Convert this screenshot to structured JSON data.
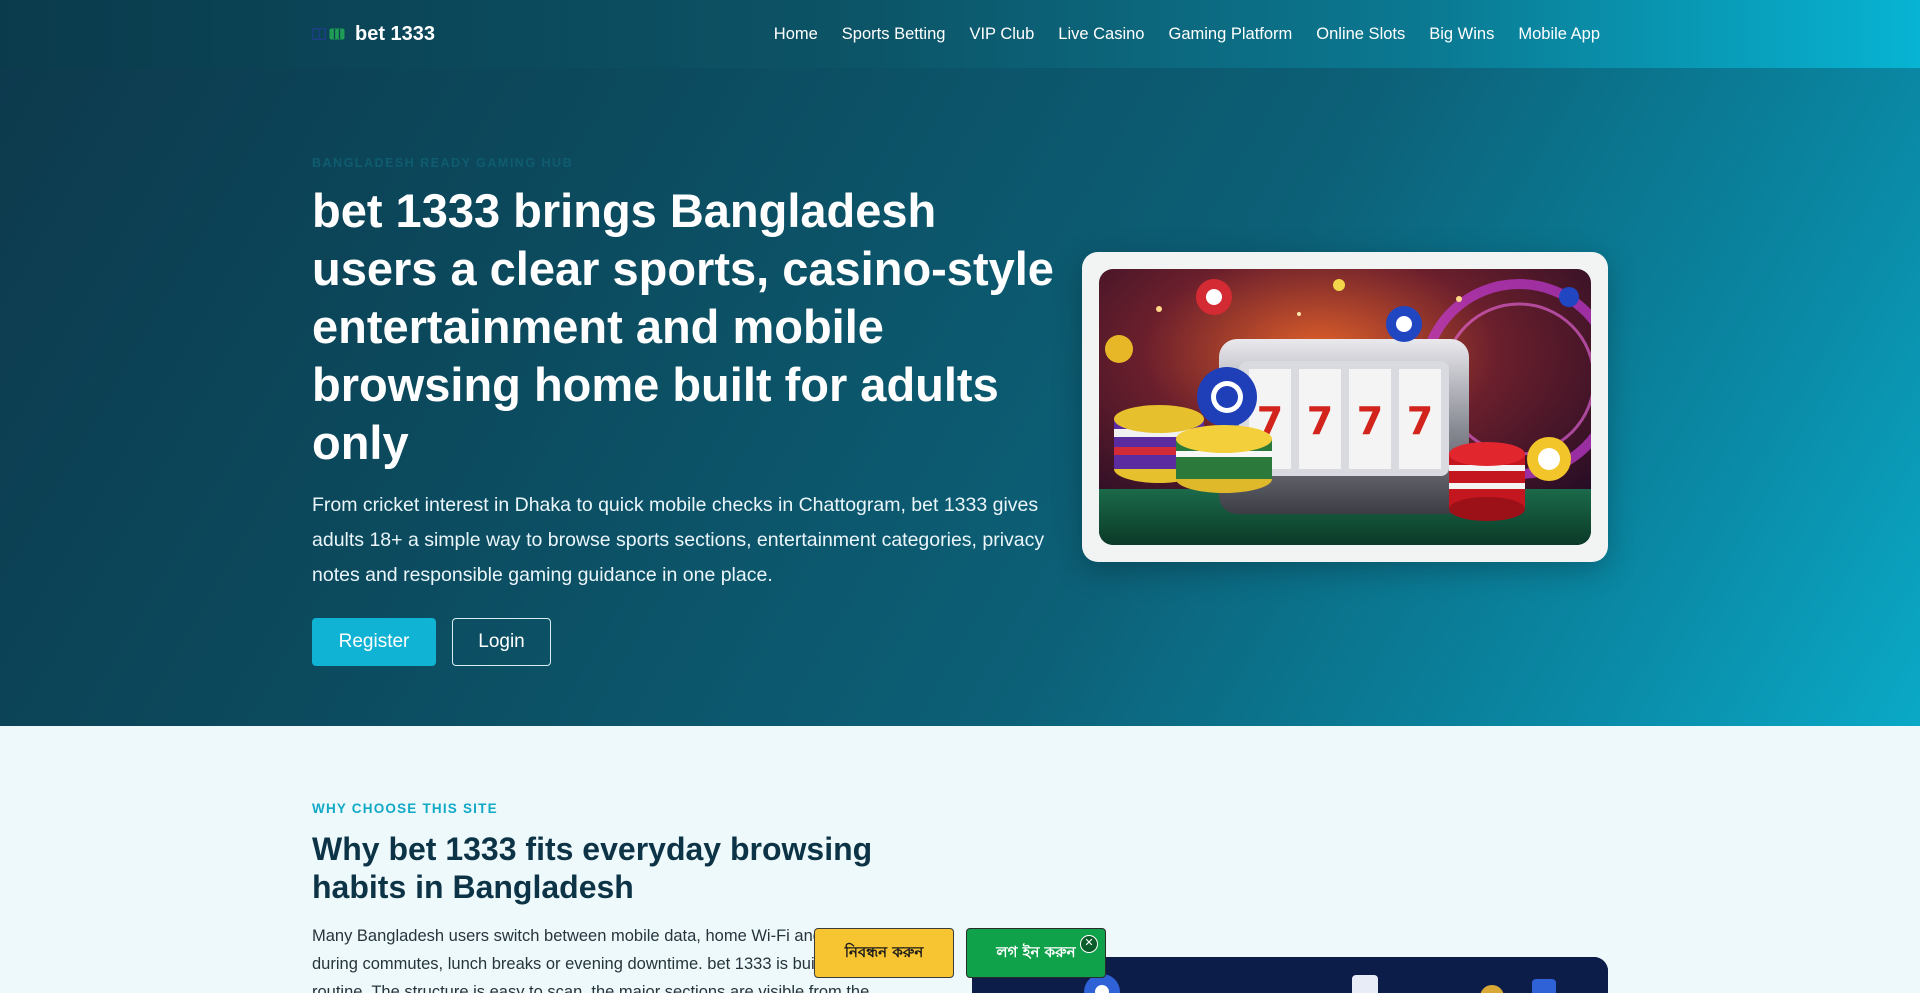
{
  "header": {
    "brand": "bet 1333",
    "nav": [
      "Home",
      "Sports Betting",
      "VIP Club",
      "Live Casino",
      "Gaming Platform",
      "Online Slots",
      "Big Wins",
      "Mobile App"
    ]
  },
  "hero": {
    "eyebrow": "Bangladesh ready gaming hub",
    "title": "bet 1333 brings Bangladesh users a clear sports, casino-style entertainment and mobile browsing home built for adults only",
    "description": "From cricket interest in Dhaka to quick mobile checks in Chattogram, bet 1333 gives adults 18+ a simple way to browse sports sections, entertainment categories, privacy notes and responsible gaming guidance in one place.",
    "register_label": "Register",
    "login_label": "Login",
    "image_icon": "slot-machine-casino-chips-image"
  },
  "why": {
    "eyebrow": "WHY CHOOSE THIS SITE",
    "title": "Why bet 1333 fits everyday browsing habits in Bangladesh",
    "body": "Many Bangladesh users switch between mobile data, home Wi-Fi and short sessions during commutes, lunch breaks or evening downtime. bet 1333 is built around that routine. The structure is easy to scan, the major sections are visible from the"
  },
  "floating": {
    "register_label": "নিবন্ধন করুন",
    "login_label": "লগ ইন করুন",
    "close_label": "✕"
  },
  "colors": {
    "accent": "#10b3d3",
    "header_dark": "#0a3b4c",
    "float_register": "#f7c531",
    "float_login": "#0fa24a"
  }
}
